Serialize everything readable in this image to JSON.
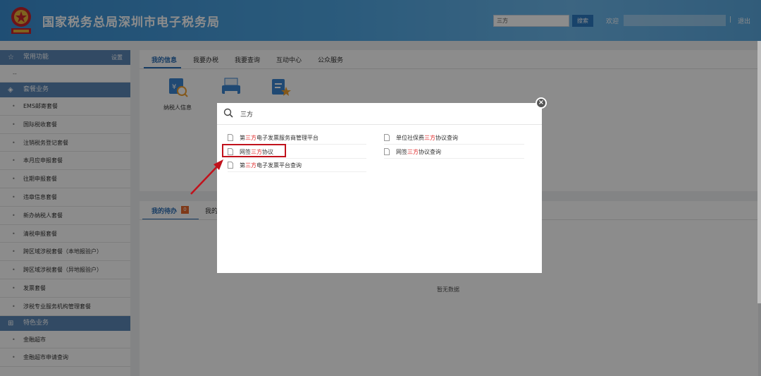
{
  "header": {
    "title": "国家税务总局深圳市电子税务局",
    "search_value": "三方",
    "search_button": "搜索",
    "welcome": "欢迎",
    "separator": "|",
    "logout": "退出"
  },
  "sidebar": {
    "common": {
      "label": "常用功能",
      "settings": "设置",
      "empty": "--"
    },
    "packages": {
      "label": "套餐业务",
      "items": [
        "EMS邮寄套餐",
        "国际税收套餐",
        "注销税务登记套餐",
        "本月应申报套餐",
        "往期申报套餐",
        "违章信息套餐",
        "新办纳税人套餐",
        "清税申报套餐",
        "跨区域涉税套餐（本地报验户）",
        "跨区域涉税套餐（异地报验户）",
        "发票套餐",
        "涉税专业服务机构管理套餐"
      ]
    },
    "featured": {
      "label": "特色业务",
      "items": [
        "金融超市",
        "金融超市申请查询"
      ]
    }
  },
  "main": {
    "tabs": [
      "我的信息",
      "我要办税",
      "我要查询",
      "互动中心",
      "公众服务"
    ],
    "apps": [
      {
        "label": "纳税人信息",
        "icon": "tax-calculator-icon"
      },
      {
        "label": "",
        "icon": "printer-icon"
      },
      {
        "label": "",
        "icon": "document-star-icon"
      }
    ],
    "todo": {
      "label": "我的待办",
      "count": "0",
      "tab2": "我的"
    },
    "empty_text": "暂无数据"
  },
  "modal": {
    "query": "三方",
    "results_left": [
      {
        "pre": "第",
        "hl": "三方",
        "post": "电子发票服务商管理平台"
      },
      {
        "pre": "网签",
        "hl": "三方",
        "post": "协议"
      },
      {
        "pre": "第",
        "hl": "三方",
        "post": "电子发票平台查询"
      }
    ],
    "results_right": [
      {
        "pre": "单位社保费",
        "hl": "三方",
        "post": "协议查询"
      },
      {
        "pre": "网签",
        "hl": "三方",
        "post": "协议查询"
      }
    ]
  },
  "colors": {
    "header_blue": "#4fa6e2",
    "sidebar_head": "#5b87b7",
    "accent": "#2a6db5",
    "highlight_red": "#e02020",
    "annotation_red": "#c1121c"
  }
}
